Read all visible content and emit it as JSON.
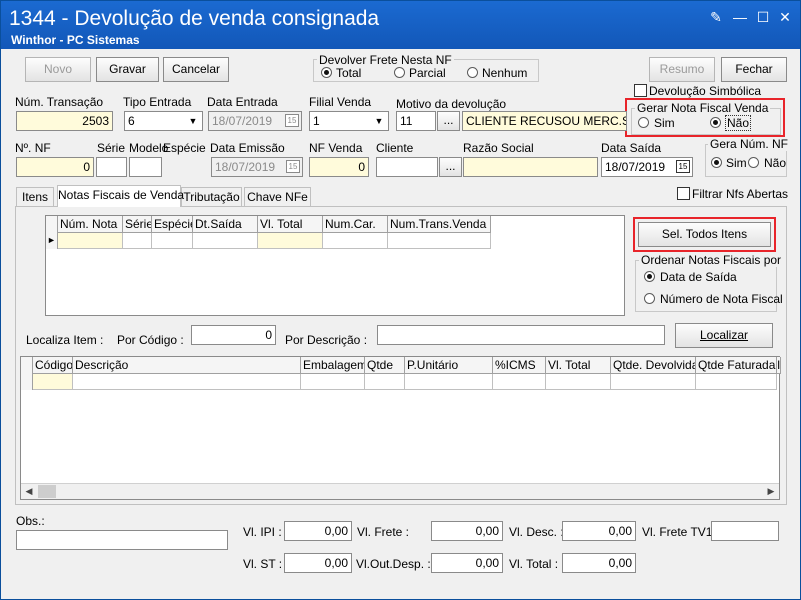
{
  "window": {
    "title": "1344 - Devolução de venda consignada",
    "subtitle": "Winthor - PC Sistemas"
  },
  "toolbar": {
    "novo": "Novo",
    "gravar": "Gravar",
    "cancelar": "Cancelar",
    "resumo": "Resumo",
    "fechar": "Fechar"
  },
  "frete": {
    "title": "Devolver Frete Nesta NF",
    "options": [
      "Total",
      "Parcial",
      "Nenhum"
    ],
    "selected": "Total"
  },
  "devolucao_simbolica": "Devolução Simbólica",
  "gerar_nf": {
    "title": "Gerar Nota Fiscal Venda",
    "sim": "Sim",
    "nao": "Não",
    "selected": "Não"
  },
  "gera_num_nf": {
    "title": "Gera Núm. NF",
    "sim": "Sim",
    "nao": "Não",
    "selected": "Sim"
  },
  "row1": {
    "num_transacao_label": "Núm. Transação",
    "num_transacao": "2503",
    "tipo_entrada_label": "Tipo Entrada",
    "tipo_entrada": "6",
    "data_entrada_label": "Data Entrada",
    "data_entrada": "18/07/2019",
    "filial_venda_label": "Filial Venda",
    "filial_venda": "1",
    "motivo_label": "Motivo da devolução",
    "motivo_code": "11",
    "motivo_text": "CLIENTE RECUSOU MERC.S/JUST"
  },
  "row2": {
    "nf_label": "Nº. NF",
    "nf": "0",
    "serie_label": "Série",
    "modelo_label": "Modelo",
    "especie_label": "Espécie",
    "data_emissao_label": "Data Emissão",
    "data_emissao": "18/07/2019",
    "nf_venda_label": "NF Venda",
    "nf_venda": "0",
    "cliente_label": "Cliente",
    "razao_label": "Razão Social",
    "data_saida_label": "Data Saída",
    "data_saida": "18/07/2019"
  },
  "ellipsis": "...",
  "calendar_icon": "15",
  "tabs": [
    "Itens",
    "Notas Fiscais de Venda",
    "Tributação",
    "Chave NFe"
  ],
  "active_tab": "Notas Fiscais de Venda",
  "filtrar": "Filtrar Nfs Abertas",
  "nf_grid": {
    "columns": [
      "Núm. Nota",
      "Série",
      "Espécie",
      "Dt.Saída",
      "Vl. Total",
      "Num.Car.",
      "Num.Trans.Venda"
    ]
  },
  "sel_todos": "Sel. Todos Itens",
  "ordenar": {
    "title": "Ordenar Notas Fiscais por",
    "options": [
      "Data de Saída",
      "Número de Nota Fiscal"
    ],
    "selected": "Data de Saída"
  },
  "localiza": {
    "label": "Localiza Item :",
    "por_codigo": "Por Código :",
    "codigo_value": "0",
    "por_descricao": "Por Descrição :",
    "button": "Localizar"
  },
  "items_grid": {
    "columns": [
      "Código",
      "Descrição",
      "Embalagem",
      "Qtde",
      "P.Unitário",
      "%ICMS",
      "Vl. Total",
      "Qtde. Devolvida",
      "Qtde Faturada",
      "I"
    ]
  },
  "obs_label": "Obs.:",
  "totals": {
    "ipi_label": "Vl. IPI :",
    "ipi": "0,00",
    "frete_label": "Vl. Frete :",
    "frete": "0,00",
    "desc_label": "Vl. Desc. :",
    "desc": "0,00",
    "frete_tv1_label": "Vl. Frete TV1:",
    "frete_tv1": "",
    "st_label": "Vl. ST :",
    "st": "0,00",
    "outdesp_label": "Vl.Out.Desp. :",
    "outdesp": "0,00",
    "total_label": "Vl. Total :",
    "total": "0,00"
  },
  "colors": {
    "title_bar": "#1257b8",
    "highlight": "#e8242a",
    "input_yellow": "#fffbdb"
  }
}
